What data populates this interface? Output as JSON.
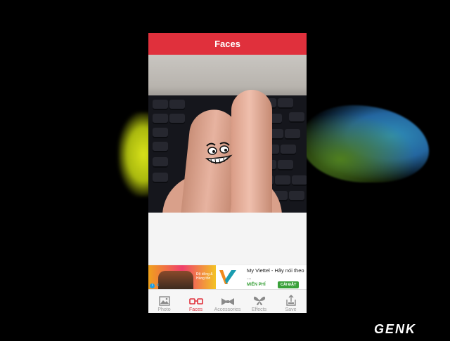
{
  "header": {
    "title": "Faces"
  },
  "ad": {
    "image_text": "Độ dông & Hàng tốn",
    "title": "My Viettel - Hãy nói theo ...",
    "price": "MIỄN PHÍ",
    "install_label": "CÀI ĐẶT",
    "info_label": "i",
    "close_label": "✕"
  },
  "tabs": [
    {
      "label": "Photo",
      "icon": "photo-icon",
      "active": false
    },
    {
      "label": "Faces",
      "icon": "glasses-icon",
      "active": true
    },
    {
      "label": "Accessories",
      "icon": "bowtie-icon",
      "active": false
    },
    {
      "label": "Effects",
      "icon": "butterfly-icon",
      "active": false
    },
    {
      "label": "Save",
      "icon": "save-icon",
      "active": false
    }
  ],
  "watermark": "GENK",
  "colors": {
    "accent": "#e0303c",
    "inactive": "#9a9a9a"
  }
}
